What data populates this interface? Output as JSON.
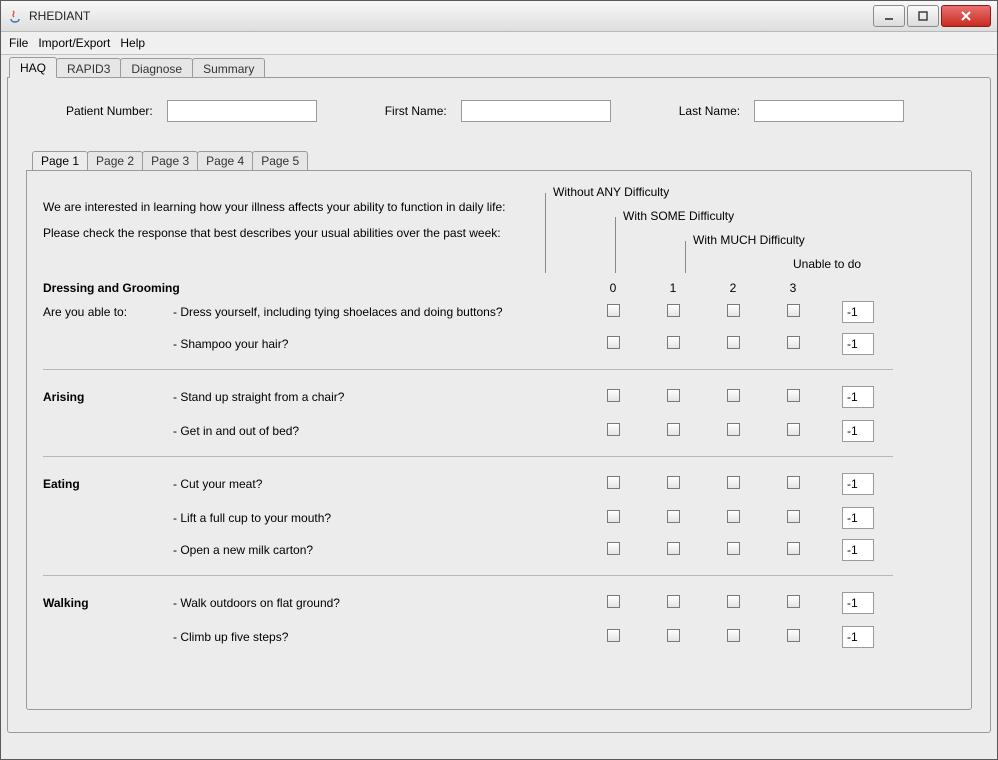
{
  "window": {
    "title": "RHEDIANT"
  },
  "menu": {
    "file": "File",
    "import_export": "Import/Export",
    "help": "Help"
  },
  "outer_tabs": {
    "t0": "HAQ",
    "t1": "RAPID3",
    "t2": "Diagnose",
    "t3": "Summary"
  },
  "patient": {
    "number_label": "Patient Number:",
    "first_name_label": "First Name:",
    "last_name_label": "Last Name:",
    "number_value": "",
    "first_name_value": "",
    "last_name_value": ""
  },
  "page_tabs": {
    "p1": "Page 1",
    "p2": "Page 2",
    "p3": "Page 3",
    "p4": "Page 4",
    "p5": "Page 5"
  },
  "intro": {
    "line1": "We are interested in learning how your illness affects your ability to function in daily life:",
    "line2": "Please check the response that best describes your usual abilities over the past week:"
  },
  "difficulty": {
    "none": "Without ANY Difficulty",
    "some": "With SOME Difficulty",
    "much": "With MUCH Difficulty",
    "unable": "Unable to do",
    "c0": "0",
    "c1": "1",
    "c2": "2",
    "c3": "3"
  },
  "able_to": "Are you able to:",
  "sections": {
    "dressing": {
      "title": "Dressing and Grooming",
      "q1": "- Dress yourself, including tying shoelaces and doing buttons?",
      "q2": "- Shampoo your hair?",
      "s1": "-1",
      "s2": "-1"
    },
    "arising": {
      "title": "Arising",
      "q1": "- Stand up straight from a chair?",
      "q2": "- Get in and out of bed?",
      "s1": "-1",
      "s2": "-1"
    },
    "eating": {
      "title": "Eating",
      "q1": "- Cut your meat?",
      "q2": "- Lift a full cup to your mouth?",
      "q3": "- Open a new milk carton?",
      "s1": "-1",
      "s2": "-1",
      "s3": "-1"
    },
    "walking": {
      "title": "Walking",
      "q1": "- Walk outdoors on flat ground?",
      "q2": "- Climb up five steps?",
      "s1": "-1",
      "s2": "-1"
    }
  }
}
